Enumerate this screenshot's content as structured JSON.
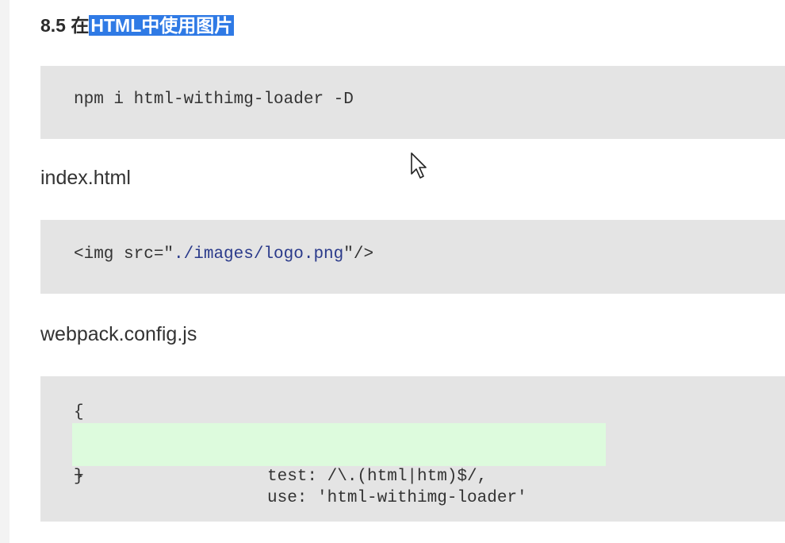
{
  "heading": {
    "number": "8.5 在",
    "highlighted": "HTML中使用图片"
  },
  "code_install": {
    "line": "npm i html-withimg-loader -D"
  },
  "label_index": "index.html",
  "code_index": {
    "prefix": "<img src=\"",
    "path": "./images/logo.png",
    "suffix": "\"/>"
  },
  "label_config": "webpack.config.js",
  "code_config": {
    "open": "{",
    "lines": [
      {
        "marker": "+",
        "content": "test: /\\.(html|htm)$/,"
      },
      {
        "marker": "+",
        "content": "use: 'html-withimg-loader'"
      }
    ],
    "close": "}"
  },
  "icons": {
    "cursor": "mouse-pointer-icon"
  },
  "colors": {
    "highlight": "#2f7ae5",
    "code_background": "#e4e4e4",
    "diff_added": "#ddfbdd"
  }
}
